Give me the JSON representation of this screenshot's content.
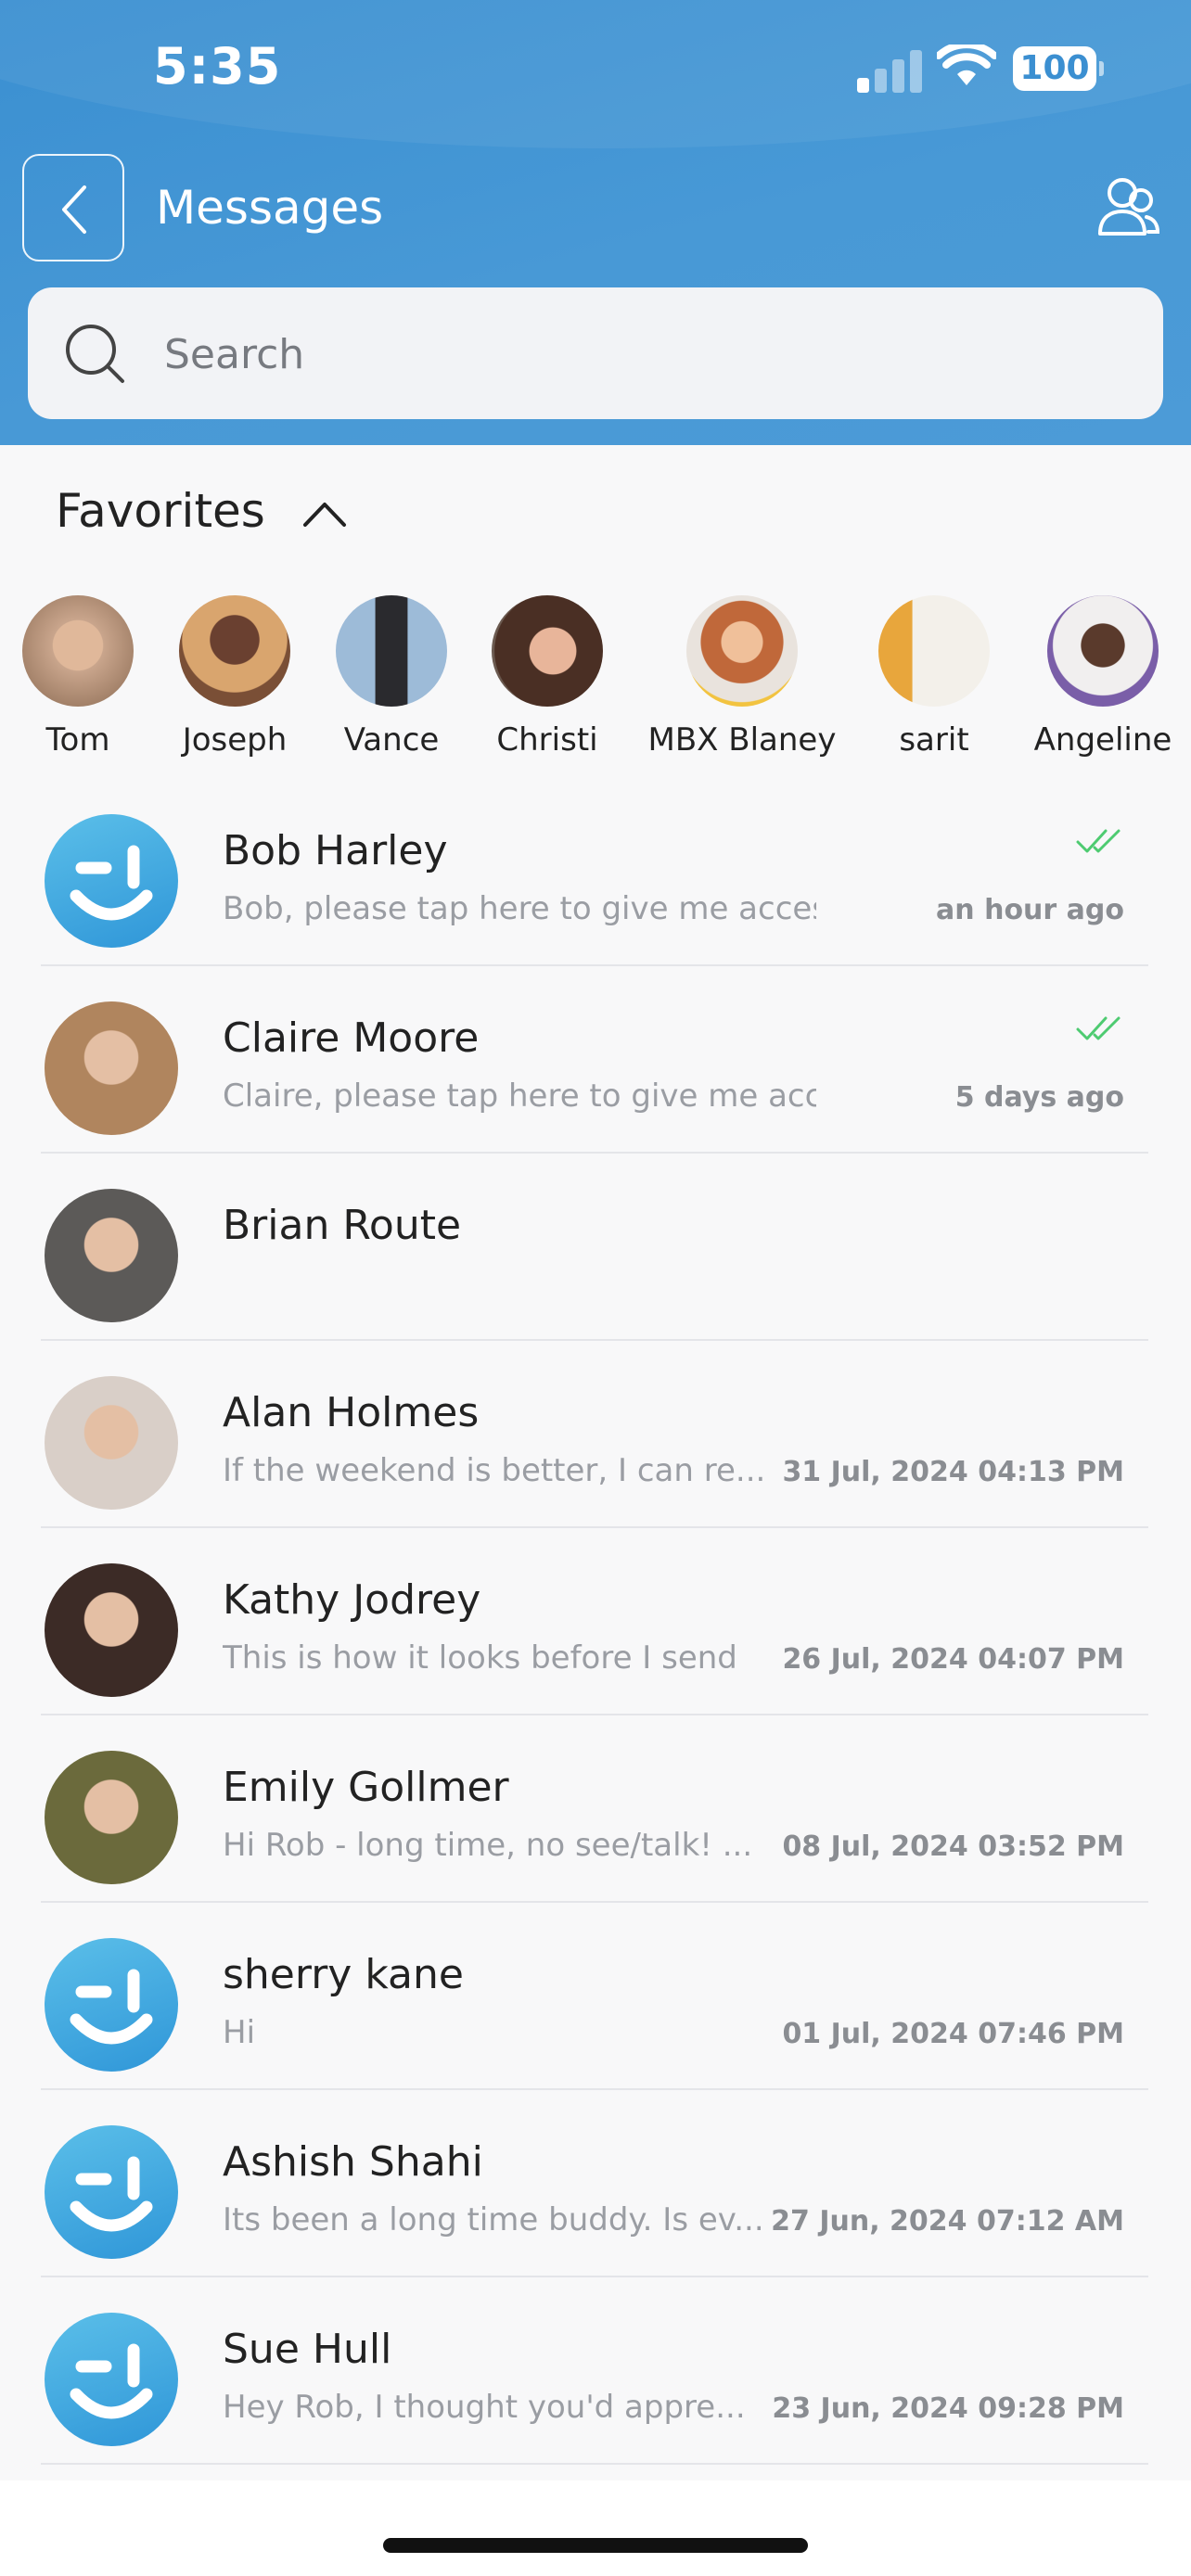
{
  "status_bar": {
    "time": "5:35",
    "battery": "100"
  },
  "header": {
    "title": "Messages"
  },
  "search": {
    "placeholder": "Search"
  },
  "favorites": {
    "title": "Favorites",
    "people": [
      {
        "name": "Tom",
        "color": "#c9a58c"
      },
      {
        "name": "Joseph",
        "color": "#7a4f36"
      },
      {
        "name": "Vance",
        "color": "#6f8fb0"
      },
      {
        "name": "Christi",
        "color": "#5b3b2e"
      },
      {
        "name": "MBX Blaney",
        "color": "#d8a060"
      },
      {
        "name": "sarit",
        "color": "#a7c25a"
      },
      {
        "name": "Angeline",
        "color": "#7a5ea8"
      }
    ]
  },
  "conversations": [
    {
      "name": "Bob Harley",
      "preview": "Bob, please tap here to give me access to ...",
      "time": "an hour ago",
      "read": true,
      "avatar": "logo"
    },
    {
      "name": "Claire Moore",
      "preview": "Claire, please tap here to give me access t...",
      "time": "5 days ago",
      "read": true,
      "avatar": "photo",
      "color": "#b0855e"
    },
    {
      "name": "Brian Route",
      "preview": "",
      "time": "",
      "read": false,
      "avatar": "photo",
      "color": "#5c5a58"
    },
    {
      "name": "Alan Holmes",
      "preview": "If the weekend is better, I can re...",
      "time": "31 Jul, 2024 04:13 PM",
      "read": false,
      "avatar": "photo",
      "color": "#d9cfc8"
    },
    {
      "name": "Kathy Jodrey",
      "preview": "This is how it looks before I send",
      "time": "26 Jul, 2024 04:07 PM",
      "read": false,
      "avatar": "photo",
      "color": "#3c2b26"
    },
    {
      "name": "Emily Gollmer",
      "preview": "Hi Rob - long time, no see/talk! ...",
      "time": "08 Jul, 2024 03:52 PM",
      "read": false,
      "avatar": "photo",
      "color": "#6b6a3c"
    },
    {
      "name": "sherry kane",
      "preview": "Hi",
      "time": "01 Jul, 2024 07:46 PM",
      "read": false,
      "avatar": "logo"
    },
    {
      "name": "Ashish Shahi",
      "preview": "Its been a long time buddy. Is ev...",
      "time": "27 Jun, 2024 07:12 AM",
      "read": false,
      "avatar": "logo"
    },
    {
      "name": "Sue Hull",
      "preview": "Hey Rob, I thought you'd appre...",
      "time": "23 Jun, 2024 09:28 PM",
      "read": false,
      "avatar": "logo"
    }
  ],
  "colors": {
    "header": "#4697d5",
    "read_tick": "#4ecb71",
    "logo": "#3ba6e0"
  }
}
